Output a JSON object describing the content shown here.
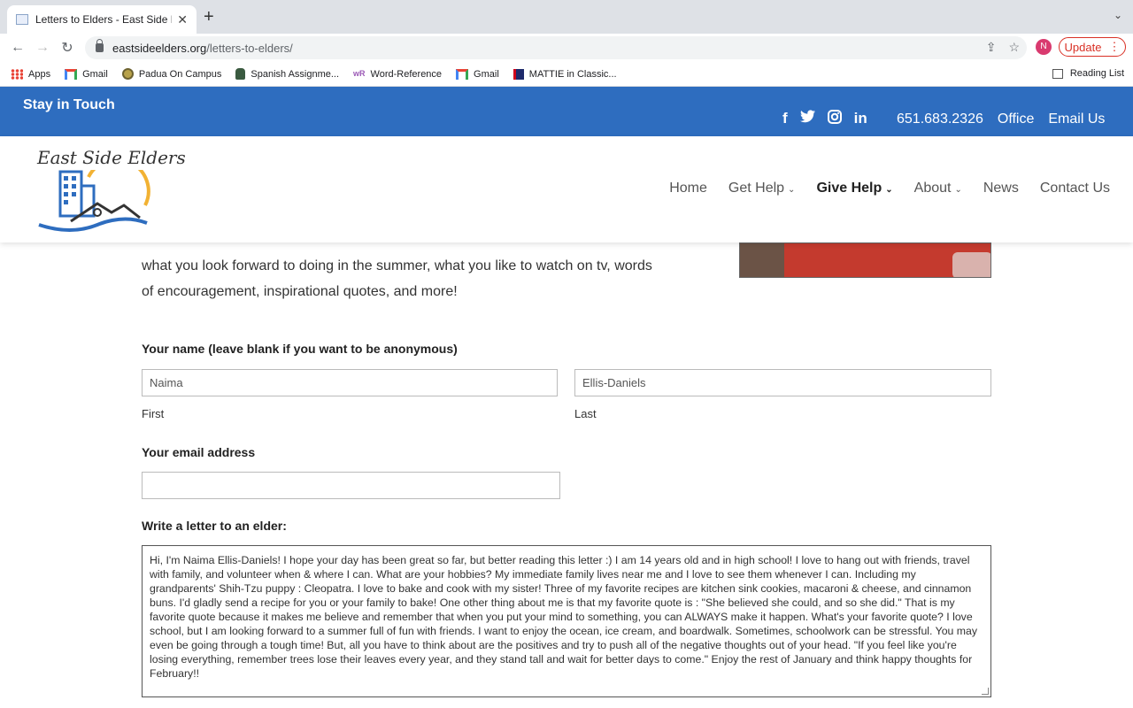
{
  "browser": {
    "tab_title": "Letters to Elders - East Side El",
    "url_host": "eastsideelders.org",
    "url_path": "/letters-to-elders/",
    "profile_initial": "N",
    "update_label": "Update",
    "bookmarks": [
      {
        "label": "Apps",
        "icon": "apps-grid-icon"
      },
      {
        "label": "Gmail",
        "icon": "gmail-icon"
      },
      {
        "label": "Padua On Campus",
        "icon": "padua-icon"
      },
      {
        "label": "Spanish Assignme...",
        "icon": "owl-icon"
      },
      {
        "label": "Word-Reference",
        "icon": "wordreference-icon"
      },
      {
        "label": "Gmail",
        "icon": "gmail-icon"
      },
      {
        "label": "MATTIE in Classic...",
        "icon": "mattie-icon"
      }
    ],
    "reading_list": "Reading List"
  },
  "topbar": {
    "stay": "Stay in Touch",
    "phone": "651.683.2326",
    "office": "Office",
    "email": "Email Us",
    "social_icons": [
      "facebook-icon",
      "twitter-icon",
      "instagram-icon",
      "linkedin-icon"
    ],
    "color": "#2e6dbf"
  },
  "header": {
    "logo_text": "East Side Elders",
    "nav": [
      {
        "label": "Home"
      },
      {
        "label": "Get Help",
        "has_dropdown": true
      },
      {
        "label": "Give Help",
        "has_dropdown": true,
        "active": true
      },
      {
        "label": "About",
        "has_dropdown": true
      },
      {
        "label": "News"
      },
      {
        "label": "Contact Us"
      }
    ]
  },
  "content": {
    "intro_line1": "what you look forward to doing in the summer, what you like to watch on tv, words",
    "intro_line2": "of encouragement, inspirational quotes, and more!",
    "name_label": "Your name (leave blank if you want to be anonymous)",
    "first_value": "Naima",
    "last_value": "Ellis-Daniels",
    "first_sub": "First",
    "last_sub": "Last",
    "email_label": "Your email address",
    "email_value": "",
    "letter_label": "Write a letter to an elder:",
    "letter_text": "Hi, I'm Naima Ellis-Daniels! I hope your day has been great so far, but better reading this letter :) I am 14 years old and in high school! I love to hang out with friends, travel with family, and volunteer when & where I can. What are your hobbies? My immediate family lives near me and I love to see them whenever I can. Including my grandparents' Shih-Tzu puppy : Cleopatra. I love to bake and cook with my sister! Three of my favorite recipes are kitchen sink cookies, macaroni & cheese, and cinnamon buns. I'd gladly send a recipe for you or your family to bake! One other thing about me is that my favorite quote is : \"She believed she could, and so she did.\" That is my favorite quote because it makes me believe and remember that when you put your mind to something, you can ALWAYS make it happen. What's your favorite quote? I love school, but I am looking forward to a summer full of fun with friends. I want to enjoy the ocean, ice cream, and boardwalk. Sometimes, schoolwork can be stressful. You may even be going through a tough time! But, all you have to think about are the positives and try to push all of the negative thoughts out of your head. \"If you feel like you're losing everything, remember trees lose their leaves every year, and they stand tall and wait for better days to come.\" Enjoy the rest of January and think happy thoughts for February!!"
  }
}
